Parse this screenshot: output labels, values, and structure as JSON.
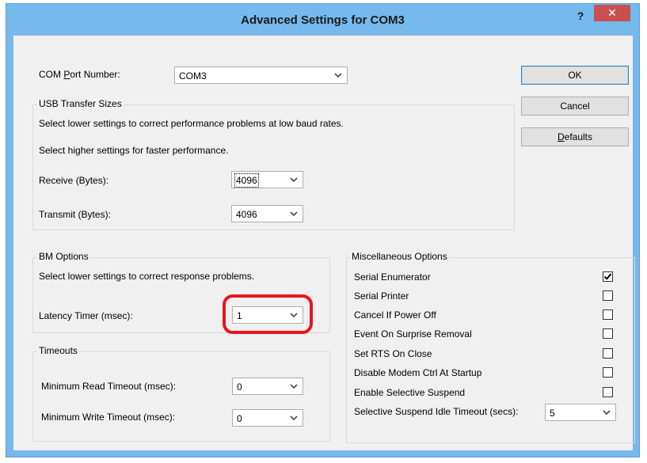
{
  "window": {
    "title": "Advanced Settings for COM3",
    "help_label": "?",
    "close_label": "✕"
  },
  "com_port": {
    "label_pre": "COM ",
    "label_hot": "P",
    "label_post": "ort Number:",
    "value": "COM3"
  },
  "buttons": {
    "ok": "OK",
    "cancel": "Cancel",
    "defaults_hot": "D",
    "defaults_rest": "efaults"
  },
  "usb": {
    "group_label": "USB Transfer Sizes",
    "desc1": "Select lower settings to correct performance problems at low baud rates.",
    "desc2": "Select higher settings for faster performance.",
    "receive_label": "Receive (Bytes):",
    "receive_value": "4096",
    "transmit_label": "Transmit (Bytes):",
    "transmit_value": "4096"
  },
  "bm": {
    "group_label": "BM Options",
    "desc": "Select lower settings to correct response problems.",
    "latency_label": "Latency Timer (msec):",
    "latency_value": "1"
  },
  "timeouts": {
    "group_label": "Timeouts",
    "min_read_label": "Minimum Read Timeout (msec):",
    "min_read_value": "0",
    "min_write_label": "Minimum Write Timeout (msec):",
    "min_write_value": "0"
  },
  "misc": {
    "group_label": "Miscellaneous Options",
    "options": [
      {
        "label": "Serial Enumerator",
        "checked": true
      },
      {
        "label": "Serial Printer",
        "checked": false
      },
      {
        "label": "Cancel If Power Off",
        "checked": false
      },
      {
        "label": "Event On Surprise Removal",
        "checked": false
      },
      {
        "label": "Set RTS On Close",
        "checked": false
      },
      {
        "label": "Disable Modem Ctrl At Startup",
        "checked": false
      },
      {
        "label": "Enable Selective Suspend",
        "checked": false
      }
    ],
    "idle_label": "Selective Suspend Idle Timeout (secs):",
    "idle_value": "5"
  },
  "colors": {
    "title_bar": "#76b9ed",
    "close_button": "#c75050",
    "highlight": "#e8151c",
    "dialog_bg": "#f0f0f0"
  },
  "icons": [
    "chevron-down-icon",
    "checkmark-icon",
    "close-icon",
    "help-icon"
  ]
}
